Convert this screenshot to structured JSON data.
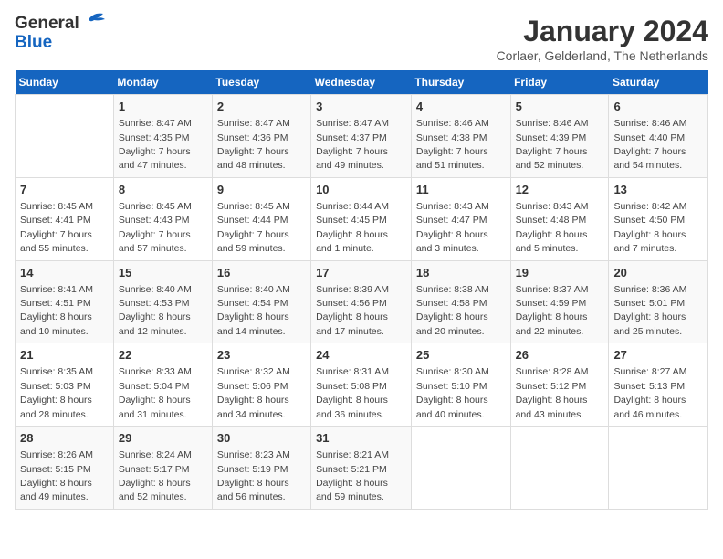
{
  "header": {
    "logo_general": "General",
    "logo_blue": "Blue",
    "month_title": "January 2024",
    "location": "Corlaer, Gelderland, The Netherlands"
  },
  "weekdays": [
    "Sunday",
    "Monday",
    "Tuesday",
    "Wednesday",
    "Thursday",
    "Friday",
    "Saturday"
  ],
  "weeks": [
    [
      {
        "day": "",
        "sunrise": "",
        "sunset": "",
        "daylight": ""
      },
      {
        "day": "1",
        "sunrise": "Sunrise: 8:47 AM",
        "sunset": "Sunset: 4:35 PM",
        "daylight": "Daylight: 7 hours and 47 minutes."
      },
      {
        "day": "2",
        "sunrise": "Sunrise: 8:47 AM",
        "sunset": "Sunset: 4:36 PM",
        "daylight": "Daylight: 7 hours and 48 minutes."
      },
      {
        "day": "3",
        "sunrise": "Sunrise: 8:47 AM",
        "sunset": "Sunset: 4:37 PM",
        "daylight": "Daylight: 7 hours and 49 minutes."
      },
      {
        "day": "4",
        "sunrise": "Sunrise: 8:46 AM",
        "sunset": "Sunset: 4:38 PM",
        "daylight": "Daylight: 7 hours and 51 minutes."
      },
      {
        "day": "5",
        "sunrise": "Sunrise: 8:46 AM",
        "sunset": "Sunset: 4:39 PM",
        "daylight": "Daylight: 7 hours and 52 minutes."
      },
      {
        "day": "6",
        "sunrise": "Sunrise: 8:46 AM",
        "sunset": "Sunset: 4:40 PM",
        "daylight": "Daylight: 7 hours and 54 minutes."
      }
    ],
    [
      {
        "day": "7",
        "sunrise": "Sunrise: 8:45 AM",
        "sunset": "Sunset: 4:41 PM",
        "daylight": "Daylight: 7 hours and 55 minutes."
      },
      {
        "day": "8",
        "sunrise": "Sunrise: 8:45 AM",
        "sunset": "Sunset: 4:43 PM",
        "daylight": "Daylight: 7 hours and 57 minutes."
      },
      {
        "day": "9",
        "sunrise": "Sunrise: 8:45 AM",
        "sunset": "Sunset: 4:44 PM",
        "daylight": "Daylight: 7 hours and 59 minutes."
      },
      {
        "day": "10",
        "sunrise": "Sunrise: 8:44 AM",
        "sunset": "Sunset: 4:45 PM",
        "daylight": "Daylight: 8 hours and 1 minute."
      },
      {
        "day": "11",
        "sunrise": "Sunrise: 8:43 AM",
        "sunset": "Sunset: 4:47 PM",
        "daylight": "Daylight: 8 hours and 3 minutes."
      },
      {
        "day": "12",
        "sunrise": "Sunrise: 8:43 AM",
        "sunset": "Sunset: 4:48 PM",
        "daylight": "Daylight: 8 hours and 5 minutes."
      },
      {
        "day": "13",
        "sunrise": "Sunrise: 8:42 AM",
        "sunset": "Sunset: 4:50 PM",
        "daylight": "Daylight: 8 hours and 7 minutes."
      }
    ],
    [
      {
        "day": "14",
        "sunrise": "Sunrise: 8:41 AM",
        "sunset": "Sunset: 4:51 PM",
        "daylight": "Daylight: 8 hours and 10 minutes."
      },
      {
        "day": "15",
        "sunrise": "Sunrise: 8:40 AM",
        "sunset": "Sunset: 4:53 PM",
        "daylight": "Daylight: 8 hours and 12 minutes."
      },
      {
        "day": "16",
        "sunrise": "Sunrise: 8:40 AM",
        "sunset": "Sunset: 4:54 PM",
        "daylight": "Daylight: 8 hours and 14 minutes."
      },
      {
        "day": "17",
        "sunrise": "Sunrise: 8:39 AM",
        "sunset": "Sunset: 4:56 PM",
        "daylight": "Daylight: 8 hours and 17 minutes."
      },
      {
        "day": "18",
        "sunrise": "Sunrise: 8:38 AM",
        "sunset": "Sunset: 4:58 PM",
        "daylight": "Daylight: 8 hours and 20 minutes."
      },
      {
        "day": "19",
        "sunrise": "Sunrise: 8:37 AM",
        "sunset": "Sunset: 4:59 PM",
        "daylight": "Daylight: 8 hours and 22 minutes."
      },
      {
        "day": "20",
        "sunrise": "Sunrise: 8:36 AM",
        "sunset": "Sunset: 5:01 PM",
        "daylight": "Daylight: 8 hours and 25 minutes."
      }
    ],
    [
      {
        "day": "21",
        "sunrise": "Sunrise: 8:35 AM",
        "sunset": "Sunset: 5:03 PM",
        "daylight": "Daylight: 8 hours and 28 minutes."
      },
      {
        "day": "22",
        "sunrise": "Sunrise: 8:33 AM",
        "sunset": "Sunset: 5:04 PM",
        "daylight": "Daylight: 8 hours and 31 minutes."
      },
      {
        "day": "23",
        "sunrise": "Sunrise: 8:32 AM",
        "sunset": "Sunset: 5:06 PM",
        "daylight": "Daylight: 8 hours and 34 minutes."
      },
      {
        "day": "24",
        "sunrise": "Sunrise: 8:31 AM",
        "sunset": "Sunset: 5:08 PM",
        "daylight": "Daylight: 8 hours and 36 minutes."
      },
      {
        "day": "25",
        "sunrise": "Sunrise: 8:30 AM",
        "sunset": "Sunset: 5:10 PM",
        "daylight": "Daylight: 8 hours and 40 minutes."
      },
      {
        "day": "26",
        "sunrise": "Sunrise: 8:28 AM",
        "sunset": "Sunset: 5:12 PM",
        "daylight": "Daylight: 8 hours and 43 minutes."
      },
      {
        "day": "27",
        "sunrise": "Sunrise: 8:27 AM",
        "sunset": "Sunset: 5:13 PM",
        "daylight": "Daylight: 8 hours and 46 minutes."
      }
    ],
    [
      {
        "day": "28",
        "sunrise": "Sunrise: 8:26 AM",
        "sunset": "Sunset: 5:15 PM",
        "daylight": "Daylight: 8 hours and 49 minutes."
      },
      {
        "day": "29",
        "sunrise": "Sunrise: 8:24 AM",
        "sunset": "Sunset: 5:17 PM",
        "daylight": "Daylight: 8 hours and 52 minutes."
      },
      {
        "day": "30",
        "sunrise": "Sunrise: 8:23 AM",
        "sunset": "Sunset: 5:19 PM",
        "daylight": "Daylight: 8 hours and 56 minutes."
      },
      {
        "day": "31",
        "sunrise": "Sunrise: 8:21 AM",
        "sunset": "Sunset: 5:21 PM",
        "daylight": "Daylight: 8 hours and 59 minutes."
      },
      {
        "day": "",
        "sunrise": "",
        "sunset": "",
        "daylight": ""
      },
      {
        "day": "",
        "sunrise": "",
        "sunset": "",
        "daylight": ""
      },
      {
        "day": "",
        "sunrise": "",
        "sunset": "",
        "daylight": ""
      }
    ]
  ]
}
